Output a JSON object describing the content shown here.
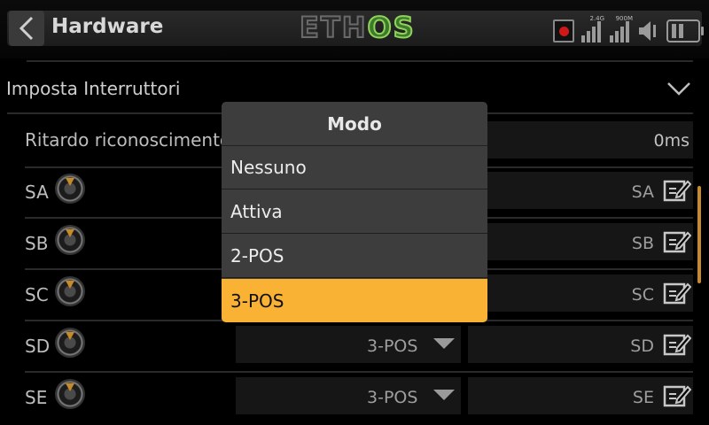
{
  "header": {
    "title": "Hardware",
    "logo_left": "ETH",
    "logo_right": "OS",
    "signal1_label": "2.4G",
    "signal2_label": "900M"
  },
  "section": {
    "label": "Imposta Interruttori"
  },
  "delay": {
    "label": "Ritardo riconoscimento",
    "value": "0ms"
  },
  "switches": [
    {
      "name": "SA",
      "mode": "",
      "display": "SA"
    },
    {
      "name": "SB",
      "mode": "",
      "display": "SB"
    },
    {
      "name": "SC",
      "mode": "",
      "display": "SC"
    },
    {
      "name": "SD",
      "mode": "3-POS",
      "display": "SD"
    },
    {
      "name": "SE",
      "mode": "3-POS",
      "display": "SE"
    }
  ],
  "dialog": {
    "title": "Modo",
    "options": [
      "Nessuno",
      "Attiva",
      "2-POS",
      "3-POS"
    ],
    "selected": "3-POS"
  },
  "colors": {
    "accent": "#f9b234",
    "logo_green": "#8fd35a",
    "record": "#d01818"
  }
}
